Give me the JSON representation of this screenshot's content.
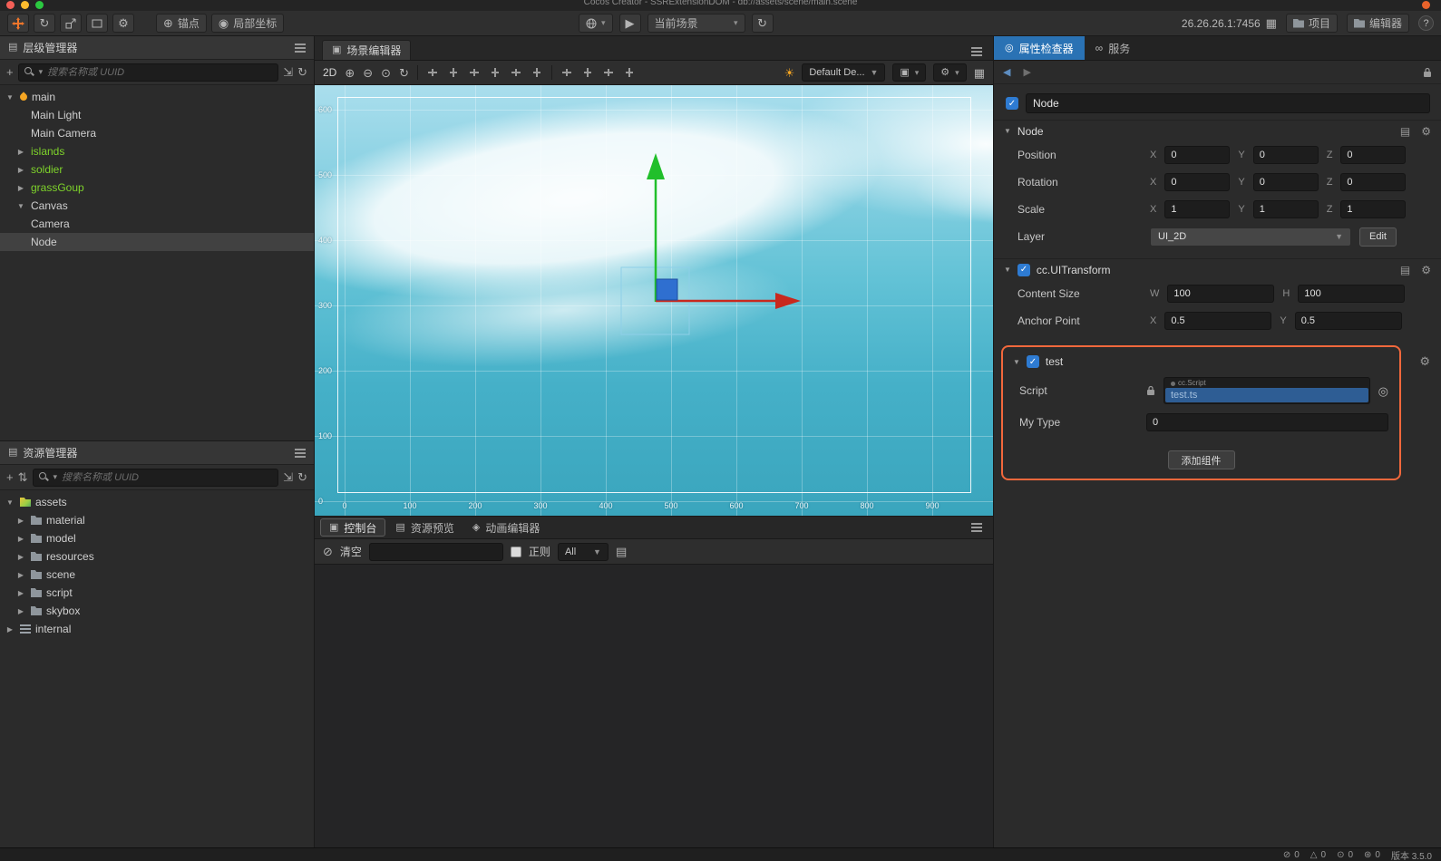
{
  "window": {
    "title": "Cocos Creator - SSRExtensionDOM - db://assets/scene/main.scene"
  },
  "toolbar": {
    "anchor": "锚点",
    "local_coords": "局部坐标",
    "current_scene": "当前场景",
    "address": "26.26.26.1:7456",
    "project": "项目",
    "editor": "编辑器",
    "help": "?"
  },
  "hierarchy": {
    "title": "层级管理器",
    "search_placeholder": "搜索名称或 UUID",
    "items": [
      {
        "label": "main"
      },
      {
        "label": "Main Light"
      },
      {
        "label": "Main Camera"
      },
      {
        "label": "islands"
      },
      {
        "label": "soldier"
      },
      {
        "label": "grassGoup"
      },
      {
        "label": "Canvas"
      },
      {
        "label": "Camera"
      },
      {
        "label": "Node"
      }
    ]
  },
  "assets": {
    "title": "资源管理器",
    "search_placeholder": "搜索名称或 UUID",
    "items": [
      {
        "label": "assets"
      },
      {
        "label": "material"
      },
      {
        "label": "model"
      },
      {
        "label": "resources"
      },
      {
        "label": "scene"
      },
      {
        "label": "script"
      },
      {
        "label": "skybox"
      },
      {
        "label": "internal"
      }
    ]
  },
  "scene": {
    "tab": "场景编辑器",
    "mode_2d": "2D",
    "camera_preset": "Default De...",
    "ruler_x": [
      "0",
      "100",
      "200",
      "300",
      "400",
      "500",
      "600",
      "700",
      "800",
      "900"
    ],
    "ruler_y": [
      "600",
      "500",
      "400",
      "300",
      "200",
      "100",
      "0"
    ]
  },
  "console": {
    "tab_console": "控制台",
    "tab_preview": "资源预览",
    "tab_animation": "动画编辑器",
    "clear": "清空",
    "regex": "正则",
    "level": "All"
  },
  "inspector": {
    "tab_inspector": "属性检查器",
    "tab_service": "服务",
    "node_name": "Node",
    "axis": {
      "x": "X",
      "y": "Y",
      "z": "Z",
      "w": "W",
      "h": "H"
    },
    "node": {
      "title": "Node",
      "position_label": "Position",
      "rotation_label": "Rotation",
      "scale_label": "Scale",
      "layer_label": "Layer",
      "position": {
        "x": "0",
        "y": "0",
        "z": "0"
      },
      "rotation": {
        "x": "0",
        "y": "0",
        "z": "0"
      },
      "scale": {
        "x": "1",
        "y": "1",
        "z": "1"
      },
      "layer": "UI_2D",
      "edit": "Edit"
    },
    "uitransform": {
      "title": "cc.UITransform",
      "content_size_label": "Content Size",
      "anchor_point_label": "Anchor Point",
      "content_w": "100",
      "content_h": "100",
      "anchor_x": "0.5",
      "anchor_y": "0.5"
    },
    "test": {
      "title": "test",
      "script_label": "Script",
      "script_type": "cc.Script",
      "script_value": "test.ts",
      "my_type_label": "My Type",
      "my_type_value": "0"
    },
    "add_component": "添加组件"
  },
  "statusbar": {
    "errors": "0",
    "warnings": "0",
    "infos": "0",
    "tasks": "0",
    "version": "版本 3.5.0"
  },
  "colors": {
    "accent_orange": "#f2683c",
    "active_tab_blue": "#2a72b4",
    "node_green": "#7ed32b",
    "axis_green": "#21bf2b",
    "axis_red": "#c8281e",
    "node_handle_blue": "#2f6fd0"
  }
}
